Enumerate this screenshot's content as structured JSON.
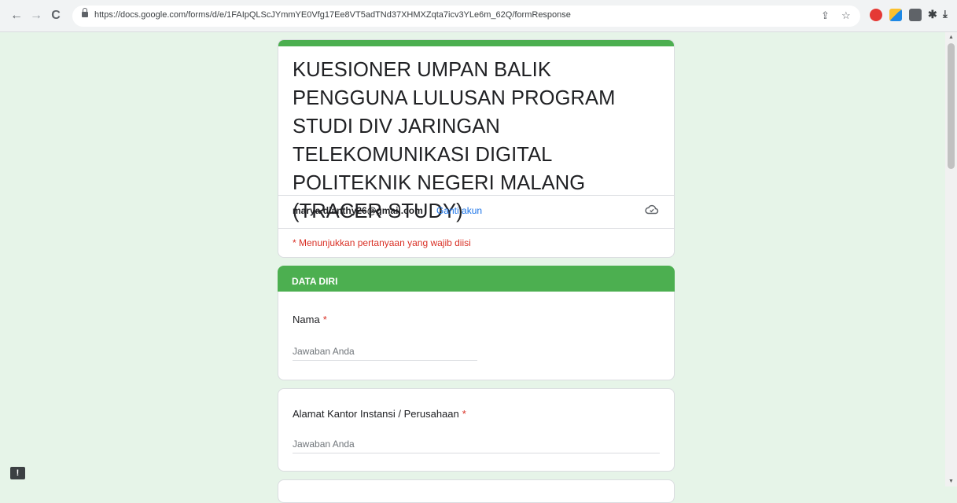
{
  "browser": {
    "back_icon": "←",
    "forward_icon": "→",
    "reload_icon": "C",
    "url": "https://docs.google.com/forms/d/e/1FAIpQLScJYmmYE0Vfg17Ee8VT5adTNd37XHMXZqta7icv3YLe6m_62Q/formResponse"
  },
  "form": {
    "title": "KUESIONER UMPAN BALIK PENGGUNA LULUSAN PROGRAM STUDI DIV JARINGAN TELEKOMUNIKASI DIGITAL POLITEKNIK NEGERI MALANG (TRACER STUDY)",
    "account_email": "marya.dianthy26@gmail.com",
    "switch_account_label": "Ganti akun",
    "required_note": "* Menunjukkan pertanyaan yang wajib diisi",
    "accent_color": "#4caf50"
  },
  "section": {
    "title": "DATA DIRI"
  },
  "questions": [
    {
      "label": "Nama",
      "required_mark": "*",
      "placeholder": "Jawaban Anda"
    },
    {
      "label": "Alamat Kantor Instansi / Perusahaan",
      "required_mark": "*",
      "placeholder": "Jawaban Anda"
    }
  ],
  "report_button_label": "!"
}
